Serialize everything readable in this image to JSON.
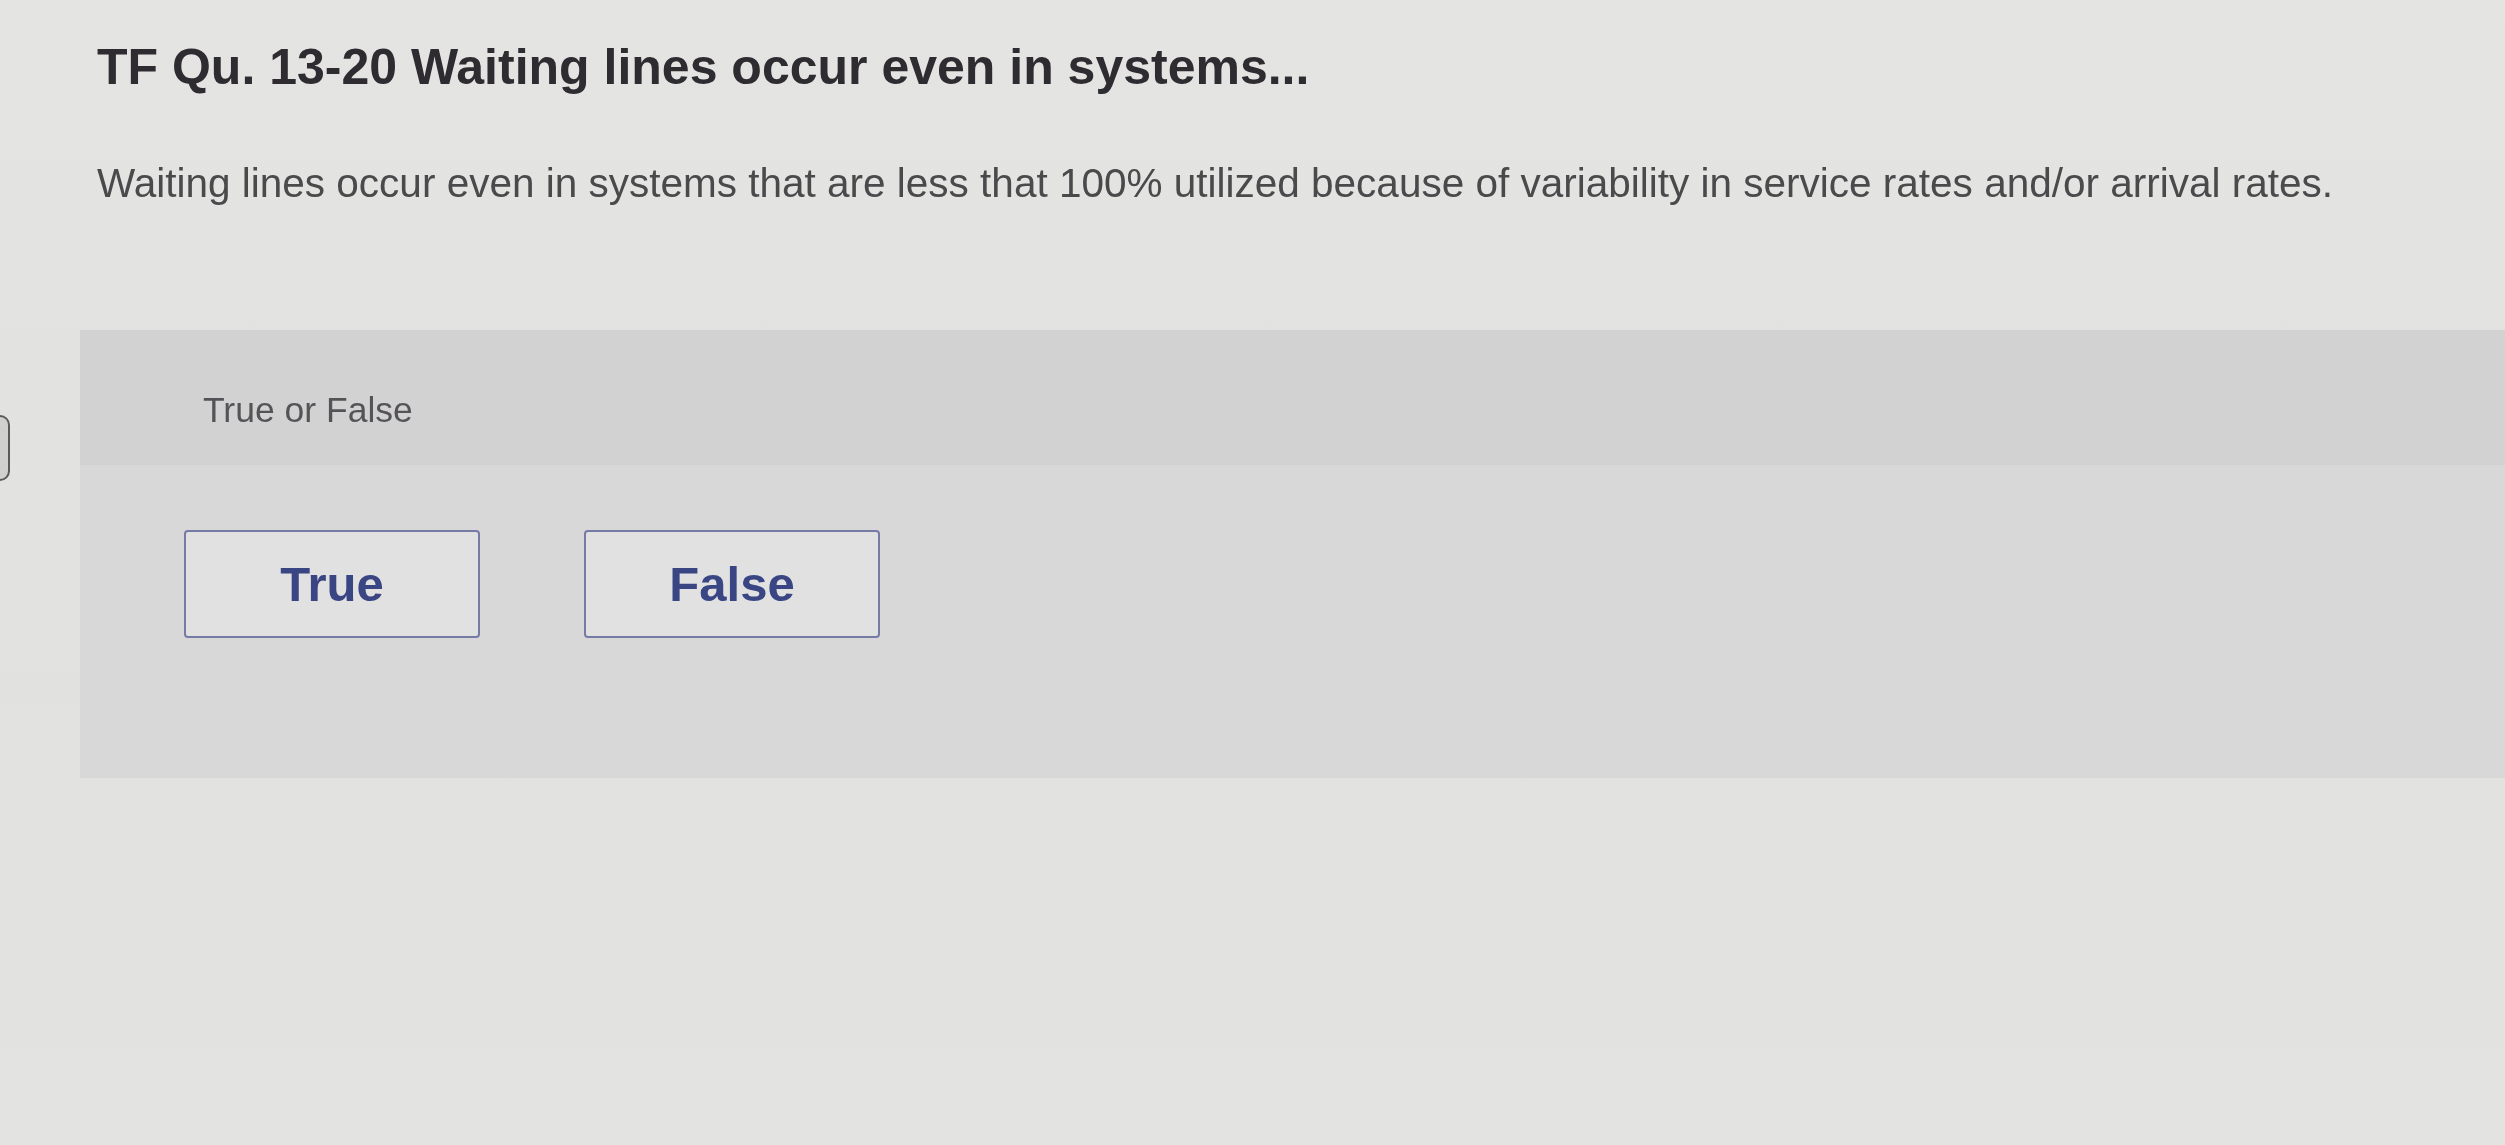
{
  "question": {
    "title": "TF Qu. 13-20 Waiting lines occur even in systems...",
    "text": "Waiting lines occur even in systems that are less that 100% utilized because of variability in service rates and/or arrival rates."
  },
  "answer_panel": {
    "prompt": "True or False",
    "options": [
      {
        "label": "True",
        "selected": false
      },
      {
        "label": "False",
        "selected": false
      }
    ]
  }
}
